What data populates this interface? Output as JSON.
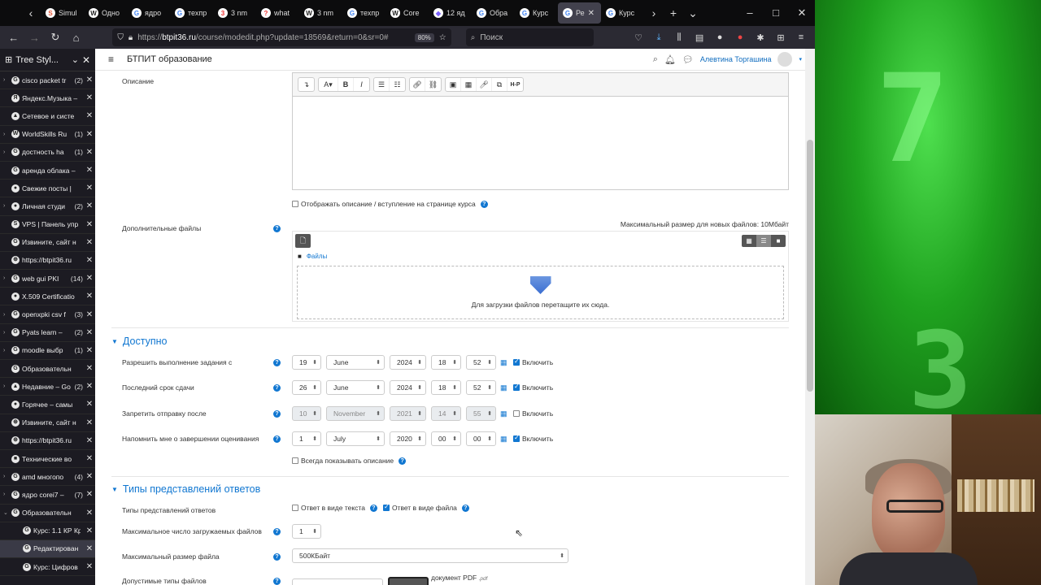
{
  "browser": {
    "tabs": [
      {
        "icon": "S",
        "label": "Simul",
        "color": "#e8593a"
      },
      {
        "icon": "W",
        "label": "Одно",
        "color": "#ffffff"
      },
      {
        "icon": "G",
        "label": "ядро",
        "color": "#4285f4"
      },
      {
        "icon": "G",
        "label": "техпр",
        "color": "#4285f4"
      },
      {
        "icon": "3",
        "label": "3 nm",
        "color": "#e33"
      },
      {
        "icon": "?",
        "label": "what",
        "color": "#e33"
      },
      {
        "icon": "W",
        "label": "3 nm",
        "color": "#ffffff"
      },
      {
        "icon": "G",
        "label": "техпр",
        "color": "#4285f4"
      },
      {
        "icon": "W",
        "label": "Core",
        "color": "#ffffff"
      },
      {
        "icon": "◆",
        "label": "12 яд",
        "color": "#7b61ff"
      },
      {
        "icon": "G",
        "label": "Обра",
        "color": "#4285f4"
      },
      {
        "icon": "G",
        "label": "Курс",
        "color": "#4285f4"
      },
      {
        "icon": "G",
        "label": "Ре",
        "color": "#4285f4"
      },
      {
        "icon": "G",
        "label": "Курс",
        "color": "#4285f4"
      }
    ],
    "url_prefix": "https://",
    "url_host": "btpit36.ru",
    "url_path": "/course/modedit.php?update=18569&return=0&sr=0#",
    "zoom": "80%",
    "search_placeholder": "Поиск"
  },
  "sidebar": {
    "title": "Tree Styl...",
    "items": [
      {
        "label": "cisco packet tr",
        "count": "(2)",
        "fav": "G",
        "arrow": "›",
        "child": false
      },
      {
        "label": "Яндекс.Музыка –",
        "count": "",
        "fav": "Я",
        "arrow": "",
        "child": false
      },
      {
        "label": "Сетевое и систе",
        "count": "",
        "fav": "▲",
        "arrow": "",
        "child": false
      },
      {
        "label": "WorldSkills Ru",
        "count": "(1)",
        "fav": "W",
        "arrow": "›",
        "child": false
      },
      {
        "label": "достность ha",
        "count": "(1)",
        "fav": "G",
        "arrow": "›",
        "child": false
      },
      {
        "label": "аренда облака –",
        "count": "",
        "fav": "G",
        "arrow": "",
        "child": false
      },
      {
        "label": "Свежие посты |",
        "count": "",
        "fav": "●",
        "arrow": "",
        "child": false
      },
      {
        "label": "Личная студи",
        "count": "(2)",
        "fav": "●",
        "arrow": "›",
        "child": false
      },
      {
        "label": "VPS | Панель упр",
        "count": "",
        "fav": "S",
        "arrow": "",
        "child": false
      },
      {
        "label": "Извините, сайт н",
        "count": "",
        "fav": "G",
        "arrow": "",
        "child": false
      },
      {
        "label": "https://btpit36.ru",
        "count": "",
        "fav": "⊕",
        "arrow": "",
        "child": false
      },
      {
        "label": "web gui PKI",
        "count": "(14)",
        "fav": "G",
        "arrow": "›",
        "child": false
      },
      {
        "label": "X.509 Certificatio",
        "count": "",
        "fav": "●",
        "arrow": "",
        "child": false
      },
      {
        "label": "openxpki csv f",
        "count": "(3)",
        "fav": "G",
        "arrow": "›",
        "child": false
      },
      {
        "label": "Pyats learn –",
        "count": "(2)",
        "fav": "G",
        "arrow": "›",
        "child": false
      },
      {
        "label": "moodle выбр",
        "count": "(1)",
        "fav": "G",
        "arrow": "›",
        "child": false
      },
      {
        "label": "Образовательн",
        "count": "",
        "fav": "G",
        "arrow": "",
        "child": false
      },
      {
        "label": "Недавние – Go",
        "count": "(2)",
        "fav": "▲",
        "arrow": "›",
        "child": false
      },
      {
        "label": "Горячее – самы",
        "count": "",
        "fav": "●",
        "arrow": "",
        "child": false
      },
      {
        "label": "Извините, сайт н",
        "count": "",
        "fav": "⊕",
        "arrow": "",
        "child": false
      },
      {
        "label": "https://btpit36.ru",
        "count": "",
        "fav": "⊕",
        "arrow": "",
        "child": false
      },
      {
        "label": "Технические во",
        "count": "",
        "fav": "■",
        "arrow": "",
        "child": false
      },
      {
        "label": "amd многопо",
        "count": "(4)",
        "fav": "G",
        "arrow": "›",
        "child": false
      },
      {
        "label": "ядро corei7 –",
        "count": "(7)",
        "fav": "G",
        "arrow": "›",
        "child": false
      },
      {
        "label": "Образовательн",
        "count": "",
        "fav": "G",
        "arrow": "⌄",
        "child": false
      },
      {
        "label": "Курс: 1.1 КР Кр",
        "count": "",
        "fav": "G",
        "arrow": "",
        "child": true
      },
      {
        "label": "Редактирован",
        "count": "",
        "fav": "G",
        "arrow": "",
        "child": true,
        "active": true
      },
      {
        "label": "Курс: Цифров",
        "count": "",
        "fav": "G",
        "arrow": "",
        "child": true
      }
    ]
  },
  "page": {
    "site_name": "БТПИТ образование",
    "user_name": "Алевтина Торгашина",
    "description_label": "Описание",
    "show_description_label": "Отображать описание / вступление на странице курса",
    "additional_files_label": "Дополнительные файлы",
    "max_size_note": "Максимальный размер для новых файлов: 10Мбайт",
    "files_folder": "Файлы",
    "drop_hint": "Для загрузки файлов перетащите их сюда.",
    "section_available": "Доступно",
    "dates": [
      {
        "label": "Разрешить выполнение задания с",
        "day": "19",
        "month": "June",
        "year": "2024",
        "hour": "18",
        "min": "52",
        "enabled": true,
        "enable_label": "Включить"
      },
      {
        "label": "Последний срок сдачи",
        "day": "26",
        "month": "June",
        "year": "2024",
        "hour": "18",
        "min": "52",
        "enabled": true,
        "enable_label": "Включить"
      },
      {
        "label": "Запретить отправку после",
        "day": "10",
        "month": "November",
        "year": "2021",
        "hour": "14",
        "min": "55",
        "enabled": false,
        "enable_label": "Включить"
      },
      {
        "label": "Напомнить мне о завершении оценивания",
        "day": "1",
        "month": "July",
        "year": "2020",
        "hour": "00",
        "min": "00",
        "enabled": true,
        "enable_label": "Включить"
      }
    ],
    "always_show_description": "Всегда показывать описание",
    "section_submission_types": "Типы представлений ответов",
    "submission_types_label": "Типы представлений ответов",
    "online_text_label": "Ответ в виде текста",
    "file_submission_label": "Ответ в виде файла",
    "max_files_label": "Максимальное число загружаемых файлов",
    "max_files_value": "1",
    "max_file_size_label": "Максимальный размер файла",
    "max_file_size_value": "500КБайт",
    "allowed_types_label": "Допустимые типы файлов",
    "allowed_type_doc": "документ PDF",
    "allowed_type_ext": ".pdf"
  }
}
